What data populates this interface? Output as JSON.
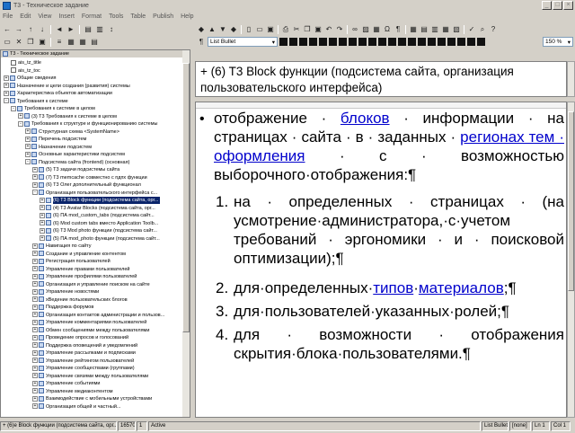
{
  "window": {
    "title": "T3 - Техническое задание"
  },
  "menu": [
    "File",
    "Edit",
    "View",
    "Insert",
    "Format",
    "Tools",
    "Table",
    "Publish",
    "Help"
  ],
  "toolbar": {
    "style": "List Bullet",
    "zoom": "150 %"
  },
  "tree": {
    "header": "T3 - Техническое задание",
    "items": [
      {
        "label": "ais_tz_title",
        "level": 1,
        "exp": "",
        "icon": "doc"
      },
      {
        "label": "ais_tz_toc",
        "level": 1,
        "exp": "",
        "icon": "doc"
      },
      {
        "label": "Общие сведения",
        "level": 0,
        "exp": "+",
        "icon": "topic"
      },
      {
        "label": "Назначение и цели создания (развития) системы",
        "level": 0,
        "exp": "+",
        "icon": "topic"
      },
      {
        "label": "Характеристика объектов автоматизации",
        "level": 0,
        "exp": "+",
        "icon": "topic"
      },
      {
        "label": "Требования к системе",
        "level": 0,
        "exp": "-",
        "icon": "topic"
      },
      {
        "label": "Требования к системе в целом",
        "level": 1,
        "exp": "-",
        "icon": "topic"
      },
      {
        "label": "(3) T3 Требования к системе в целом",
        "level": 2,
        "exp": "+",
        "icon": "topic"
      },
      {
        "label": "Требования к структуре и функционированию системы",
        "level": 2,
        "exp": "-",
        "icon": "topic"
      },
      {
        "label": "Структурная схема <SystemName>",
        "level": 3,
        "exp": "+",
        "icon": "topic"
      },
      {
        "label": "Перечень подсистем",
        "level": 3,
        "exp": "+",
        "icon": "topic"
      },
      {
        "label": "Назначение подсистем",
        "level": 3,
        "exp": "+",
        "icon": "topic"
      },
      {
        "label": "Основные характеристики подсистем",
        "level": 3,
        "exp": "+",
        "icon": "topic"
      },
      {
        "label": "Подсистема сайта (frontend) (основная)",
        "level": 3,
        "exp": "-",
        "icon": "topic"
      },
      {
        "label": "(5) T3 задачи подсистемы сайта",
        "level": 4,
        "exp": "+",
        "icon": "topic"
      },
      {
        "label": "(7) T3 memcache совместно с пдпх функции",
        "level": 4,
        "exp": "+",
        "icon": "topic"
      },
      {
        "label": "(6) T3 Олег дополнительный функционал",
        "level": 4,
        "exp": "+",
        "icon": "topic"
      },
      {
        "label": "Организация пользовательского интерфейса с...",
        "level": 4,
        "exp": "-",
        "icon": "topic"
      },
      {
        "label": "(6) T3 Block функции (подсистема сайта, орг...",
        "level": 5,
        "exp": "+",
        "icon": "topic",
        "selected": true
      },
      {
        "label": "(4) T3 Avatar Blocks (подсистема сайта, орг...",
        "level": 5,
        "exp": "+",
        "icon": "topic"
      },
      {
        "label": "(6) ПА mod_custom_tabs (подсистема сайт...",
        "level": 5,
        "exp": "+",
        "icon": "topic"
      },
      {
        "label": "(6) Mod custom tabs вместо Application Toolb...",
        "level": 5,
        "exp": "+",
        "icon": "topic"
      },
      {
        "label": "(6) T3 Mod photo функции (подсистема сайт...",
        "level": 5,
        "exp": "+",
        "icon": "topic"
      },
      {
        "label": "(5) ПА mod_photo функции (подсистема сайт...",
        "level": 5,
        "exp": "+",
        "icon": "topic"
      },
      {
        "label": "Навигация по сайту",
        "level": 4,
        "exp": "+",
        "icon": "topic"
      },
      {
        "label": "Создание и управление контентом",
        "level": 4,
        "exp": "+",
        "icon": "topic"
      },
      {
        "label": "Регистрация пользователей",
        "level": 4,
        "exp": "+",
        "icon": "topic"
      },
      {
        "label": "Управление правами пользователей",
        "level": 4,
        "exp": "+",
        "icon": "topic"
      },
      {
        "label": "Управление профилями пользователей",
        "level": 4,
        "exp": "+",
        "icon": "topic"
      },
      {
        "label": "Организация и управление поиском на сайте",
        "level": 4,
        "exp": "+",
        "icon": "topic"
      },
      {
        "label": "Управление новостями",
        "level": 4,
        "exp": "+",
        "icon": "topic"
      },
      {
        "label": "хВедение пользовательских блогов",
        "level": 4,
        "exp": "+",
        "icon": "topic"
      },
      {
        "label": "Поддержка форумов",
        "level": 4,
        "exp": "+",
        "icon": "topic"
      },
      {
        "label": "Организация контактов администрации и пользов...",
        "level": 4,
        "exp": "+",
        "icon": "topic"
      },
      {
        "label": "Управление комментариями пользователей",
        "level": 4,
        "exp": "+",
        "icon": "topic"
      },
      {
        "label": "Обмен сообщениями между пользователями",
        "level": 4,
        "exp": "+",
        "icon": "topic"
      },
      {
        "label": "Проведение опросов и голосований",
        "level": 4,
        "exp": "+",
        "icon": "topic"
      },
      {
        "label": "Поддержка оповещений и уведомлений",
        "level": 4,
        "exp": "+",
        "icon": "topic"
      },
      {
        "label": "Управление рассылками и подписками",
        "level": 4,
        "exp": "+",
        "icon": "topic"
      },
      {
        "label": "Управление рейтингом пользователей",
        "level": 4,
        "exp": "+",
        "icon": "topic"
      },
      {
        "label": "Управление сообществами (группами)",
        "level": 4,
        "exp": "+",
        "icon": "topic"
      },
      {
        "label": "Управление связями между пользователями",
        "level": 4,
        "exp": "+",
        "icon": "topic"
      },
      {
        "label": "Управление событиями",
        "level": 4,
        "exp": "+",
        "icon": "topic"
      },
      {
        "label": "Управление медиаконтентом",
        "level": 4,
        "exp": "+",
        "icon": "topic"
      },
      {
        "label": "Взаимодействие с мобильными устройствами",
        "level": 4,
        "exp": "+",
        "icon": "topic"
      },
      {
        "label": "Организация общей и частный...",
        "level": 4,
        "exp": "+",
        "icon": "topic"
      }
    ]
  },
  "header_pane": {
    "text": "+ (6) T3 Block функции (подсистема сайта, организация пользовательского интерфейса)"
  },
  "document": {
    "bullet": {
      "parts": [
        {
          "t": "отображение · ",
          "link": false
        },
        {
          "t": "блоков",
          "link": true
        },
        {
          "t": " · информации · на страницах · сайта · в · заданных · ",
          "link": false
        },
        {
          "t": "регионах тем · оформления",
          "link": true
        },
        {
          "t": " · с · возможностью выборочного·отображения:¶",
          "link": false
        }
      ]
    },
    "items": [
      {
        "n": "1.",
        "parts": [
          {
            "t": "на · определенных · страницах · (на усмотрение·администратора,·с·учетом требований · эргономики · и · поисковой оптимизации);¶",
            "link": false
          }
        ]
      },
      {
        "n": "2.",
        "parts": [
          {
            "t": "для·определенных·",
            "link": false
          },
          {
            "t": "типов",
            "link": true
          },
          {
            "t": "·",
            "link": false
          },
          {
            "t": "материалов",
            "link": true
          },
          {
            "t": ";¶",
            "link": false
          }
        ]
      },
      {
        "n": "3.",
        "parts": [
          {
            "t": "для·пользователей·указанных·ролей;¶",
            "link": false
          }
        ]
      },
      {
        "n": "4.",
        "parts": [
          {
            "t": "для · возможности · отображения скрытия·блока·пользователями.¶",
            "link": false
          }
        ]
      }
    ]
  },
  "statusbar": {
    "left": "+ (6)e  Block функции (подсистема сайта, орг...",
    "num": "16570",
    "one": "1",
    "mode": "Active",
    "style": "List Bullet",
    "none": "[none]",
    "ln": "Ln 1",
    "col": "Col 1"
  }
}
